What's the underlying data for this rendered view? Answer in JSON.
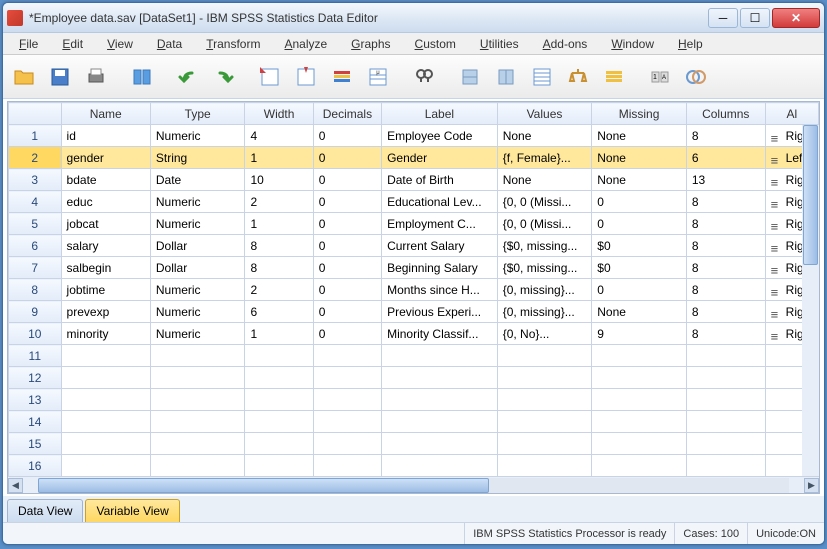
{
  "window": {
    "title": "*Employee data.sav [DataSet1] - IBM SPSS Statistics Data Editor"
  },
  "menu": [
    "File",
    "Edit",
    "View",
    "Data",
    "Transform",
    "Analyze",
    "Graphs",
    "Custom",
    "Utilities",
    "Add-ons",
    "Window",
    "Help"
  ],
  "toolbar_icons": [
    "open",
    "save",
    "print",
    "recall",
    "undo",
    "redo",
    "goto-case",
    "goto-var",
    "variables",
    "run",
    "find",
    "insert-case",
    "split",
    "weight",
    "select",
    "value-labels",
    "use-sets",
    "spellcheck"
  ],
  "columns": [
    "",
    "Name",
    "Type",
    "Width",
    "Decimals",
    "Label",
    "Values",
    "Missing",
    "Columns",
    "Al"
  ],
  "selected_row_index": 1,
  "rows": [
    {
      "n": "1",
      "name": "id",
      "type": "Numeric",
      "width": "4",
      "dec": "0",
      "label": "Employee Code",
      "values": "None",
      "missing": "None",
      "cols": "8",
      "align": "Righ"
    },
    {
      "n": "2",
      "name": "gender",
      "type": "String",
      "width": "1",
      "dec": "0",
      "label": "Gender",
      "values": "{f, Female}...",
      "missing": "None",
      "cols": "6",
      "align": "Left"
    },
    {
      "n": "3",
      "name": "bdate",
      "type": "Date",
      "width": "10",
      "dec": "0",
      "label": "Date of Birth",
      "values": "None",
      "missing": "None",
      "cols": "13",
      "align": "Righ"
    },
    {
      "n": "4",
      "name": "educ",
      "type": "Numeric",
      "width": "2",
      "dec": "0",
      "label": "Educational Lev...",
      "values": "{0, 0 (Missi...",
      "missing": "0",
      "cols": "8",
      "align": "Righ"
    },
    {
      "n": "5",
      "name": "jobcat",
      "type": "Numeric",
      "width": "1",
      "dec": "0",
      "label": "Employment C...",
      "values": "{0, 0 (Missi...",
      "missing": "0",
      "cols": "8",
      "align": "Righ"
    },
    {
      "n": "6",
      "name": "salary",
      "type": "Dollar",
      "width": "8",
      "dec": "0",
      "label": "Current Salary",
      "values": "{$0, missing...",
      "missing": "$0",
      "cols": "8",
      "align": "Righ"
    },
    {
      "n": "7",
      "name": "salbegin",
      "type": "Dollar",
      "width": "8",
      "dec": "0",
      "label": "Beginning Salary",
      "values": "{$0, missing...",
      "missing": "$0",
      "cols": "8",
      "align": "Righ"
    },
    {
      "n": "8",
      "name": "jobtime",
      "type": "Numeric",
      "width": "2",
      "dec": "0",
      "label": "Months since H...",
      "values": "{0, missing}...",
      "missing": "0",
      "cols": "8",
      "align": "Righ"
    },
    {
      "n": "9",
      "name": "prevexp",
      "type": "Numeric",
      "width": "6",
      "dec": "0",
      "label": "Previous Experi...",
      "values": "{0, missing}...",
      "missing": "None",
      "cols": "8",
      "align": "Righ"
    },
    {
      "n": "10",
      "name": "minority",
      "type": "Numeric",
      "width": "1",
      "dec": "0",
      "label": "Minority Classif...",
      "values": "{0, No}...",
      "missing": "9",
      "cols": "8",
      "align": "Righ"
    }
  ],
  "empty_rows": [
    "11",
    "12",
    "13",
    "14",
    "15",
    "16"
  ],
  "tabs": {
    "data_view": "Data View",
    "variable_view": "Variable View"
  },
  "status": {
    "processor": "IBM SPSS Statistics Processor is ready",
    "cases": "Cases: 100",
    "unicode": "Unicode:ON"
  }
}
